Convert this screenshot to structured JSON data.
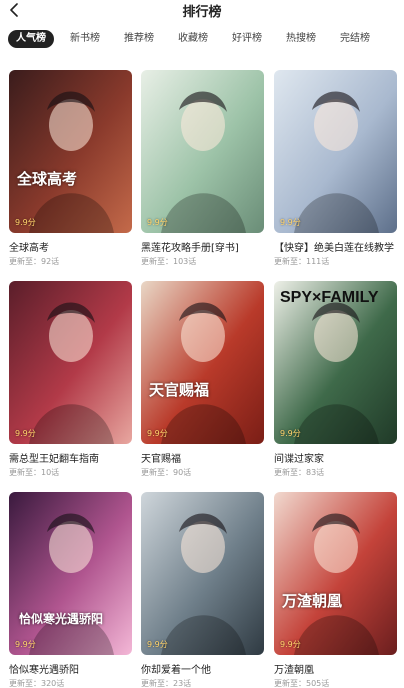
{
  "header": {
    "title": "排行榜"
  },
  "tabs": [
    {
      "label": "人气榜"
    },
    {
      "label": "新书榜"
    },
    {
      "label": "推荐榜"
    },
    {
      "label": "收藏榜"
    },
    {
      "label": "好评榜"
    },
    {
      "label": "热搜榜"
    },
    {
      "label": "完结榜"
    }
  ],
  "update_prefix": "更新至：",
  "books": [
    {
      "name": "全球高考",
      "score": "9.9分",
      "chapters": "92话",
      "cover_text": "全球高考",
      "colors": [
        "#3a1c1c",
        "#8a3a2c",
        "#c46a4a"
      ]
    },
    {
      "name": "黑莲花攻略手册[穿书]",
      "score": "9.9分",
      "chapters": "103话",
      "cover_text": "",
      "colors": [
        "#e8efe6",
        "#9dc3a8",
        "#6a8d77"
      ]
    },
    {
      "name": "【快穿】绝美白莲在线教学",
      "score": "9.9分",
      "chapters": "111话",
      "cover_text": "",
      "colors": [
        "#dfe7ef",
        "#a9b9cf",
        "#5d6f8a"
      ]
    },
    {
      "name": "需总型王妃翻车指南",
      "score": "9.9分",
      "chapters": "10话",
      "cover_text": "",
      "colors": [
        "#5a1e2a",
        "#b23a48",
        "#e8a7a0"
      ]
    },
    {
      "name": "天官赐福",
      "score": "9.9分",
      "chapters": "90话",
      "cover_text": "天官赐福",
      "colors": [
        "#e9d7c6",
        "#b93a2a",
        "#7a1e16"
      ]
    },
    {
      "name": "间谍过家家",
      "score": "9.9分",
      "chapters": "83话",
      "cover_text": "SPY×FAMILY",
      "colors": [
        "#eef0e8",
        "#3f6a4a",
        "#203a28"
      ]
    },
    {
      "name": "恰似寒光遇骄阳",
      "score": "9.9分",
      "chapters": "320话",
      "cover_text": "恰似寒光遇骄阳",
      "colors": [
        "#3a1a3e",
        "#b0558f",
        "#f3b7d6"
      ]
    },
    {
      "name": "你却爱着一个他",
      "score": "9.9分",
      "chapters": "23话",
      "cover_text": "",
      "colors": [
        "#cfd6db",
        "#6f7f8a",
        "#2f3a42"
      ]
    },
    {
      "name": "万渣朝凰",
      "score": "9.9分",
      "chapters": "505话",
      "cover_text": "万渣朝凰",
      "colors": [
        "#f1d9cf",
        "#c4433a",
        "#6a1e1e"
      ]
    }
  ]
}
